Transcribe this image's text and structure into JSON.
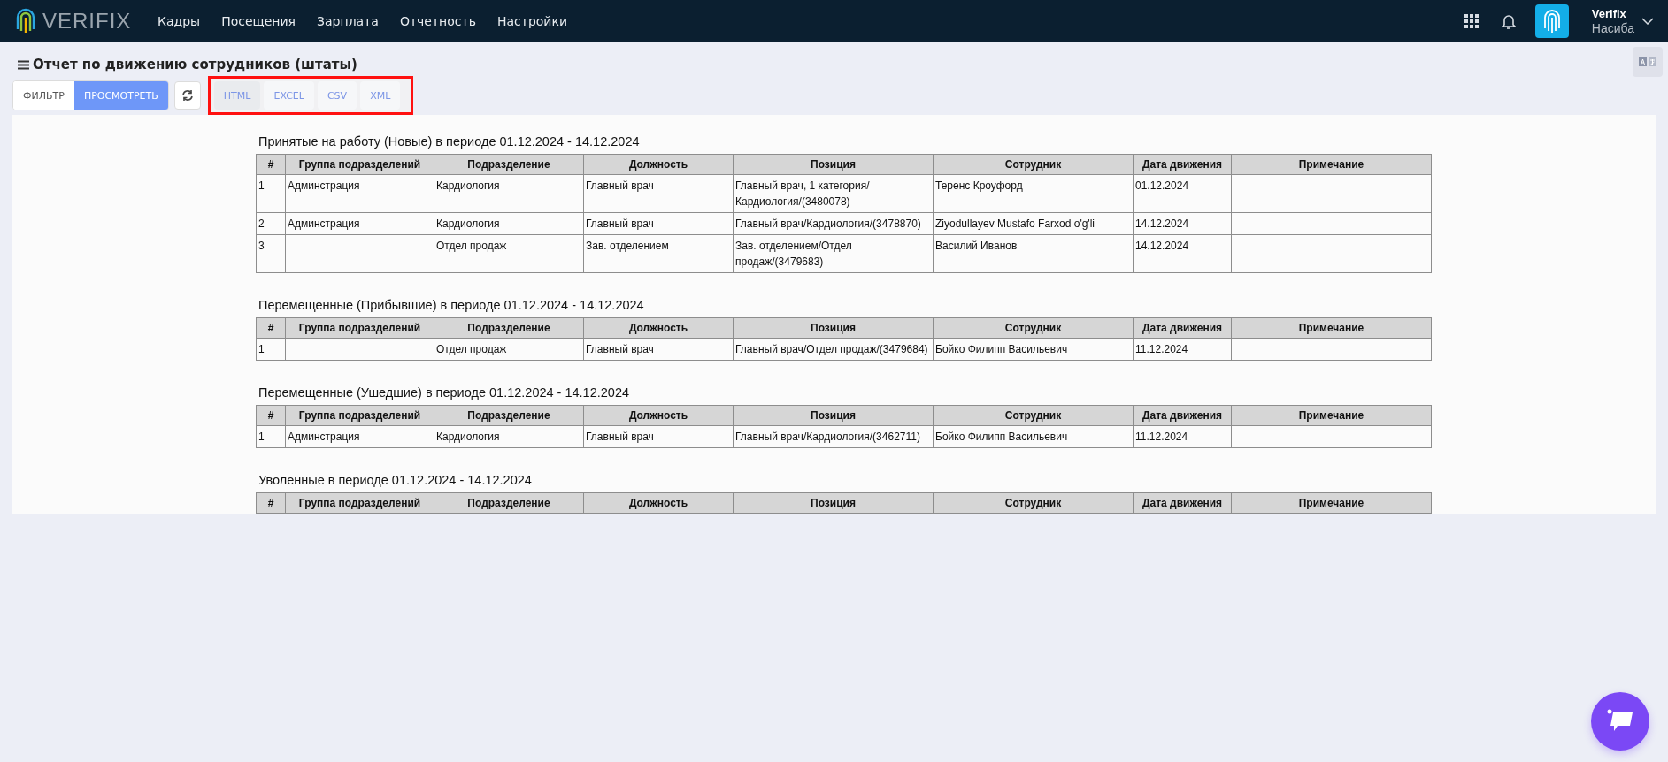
{
  "header": {
    "logo_text": "VERIFIX",
    "nav": [
      {
        "label": "Кадры",
        "selected": false
      },
      {
        "label": "Посещения",
        "selected": false
      },
      {
        "label": "Зарплата",
        "selected": false
      },
      {
        "label": "Отчетность",
        "selected": false
      },
      {
        "label": "Настройки",
        "selected": false
      }
    ],
    "user": {
      "company": "Verifix",
      "name": "Насиба"
    }
  },
  "page": {
    "title": "Отчет по движению сотрудников (штаты)",
    "view_tabs": [
      {
        "label": "ФИЛЬТР",
        "selected": false
      },
      {
        "label": "ПРОСМОТРЕТЬ",
        "selected": true
      }
    ],
    "export_buttons": [
      {
        "label": "HTML",
        "selected": true
      },
      {
        "label": "EXCEL",
        "selected": false
      },
      {
        "label": "CSV",
        "selected": false
      },
      {
        "label": "XML",
        "selected": false
      }
    ]
  },
  "sections": [
    {
      "title": "Принятые на работу (Новые) в периоде 01.12.2024 - 14.12.2024",
      "columns": [
        "#",
        "Группа подразделений",
        "Подразделение",
        "Должность",
        "Позиция",
        "Сотрудник",
        "Дата движения",
        "Примечание"
      ],
      "rows": [
        [
          "1",
          "Админстрация",
          "Кардиология",
          "Главный врач",
          "Главный врач, 1 категория/ Кардиология/(3480078)",
          "Теренс Кроуфорд",
          "01.12.2024",
          null
        ],
        [
          "2",
          "Админстрация",
          "Кардиология",
          "Главный врач",
          "Главный врач/Кардиология/(3478870)",
          "Ziyodullayev Mustafo Farxod o'g'li",
          "14.12.2024",
          null
        ],
        [
          "3",
          null,
          "Отдел продаж",
          "Зав. отделением",
          "Зав. отделением/Отдел продаж/(3479683)",
          "Василий Иванов",
          "14.12.2024",
          null
        ]
      ]
    },
    {
      "title": "Перемещенные (Прибывшие) в периоде 01.12.2024 - 14.12.2024",
      "columns": [
        "#",
        "Группа подразделений",
        "Подразделение",
        "Должность",
        "Позиция",
        "Сотрудник",
        "Дата движения",
        "Примечание"
      ],
      "rows": [
        [
          "1",
          null,
          "Отдел продаж",
          "Главный врач",
          "Главный врач/Отдел продаж/(3479684)",
          "Бойко Филипп Васильевич",
          "11.12.2024",
          null
        ]
      ]
    },
    {
      "title": "Перемещенные (Ушедшие) в периоде 01.12.2024 - 14.12.2024",
      "columns": [
        "#",
        "Группа подразделений",
        "Подразделение",
        "Должность",
        "Позиция",
        "Сотрудник",
        "Дата движения",
        "Примечание"
      ],
      "rows": [
        [
          "1",
          "Админстрация",
          "Кардиология",
          "Главный врач",
          "Главный врач/Кардиология/(3462711)",
          "Бойко Филипп Васильевич",
          "11.12.2024",
          null
        ]
      ]
    },
    {
      "title": "Уволенные в периоде 01.12.2024 - 14.12.2024",
      "columns": [
        "#",
        "Группа подразделений",
        "Подразделение",
        "Должность",
        "Позиция",
        "Сотрудник",
        "Дата движения",
        "Примечание"
      ]
    }
  ]
}
